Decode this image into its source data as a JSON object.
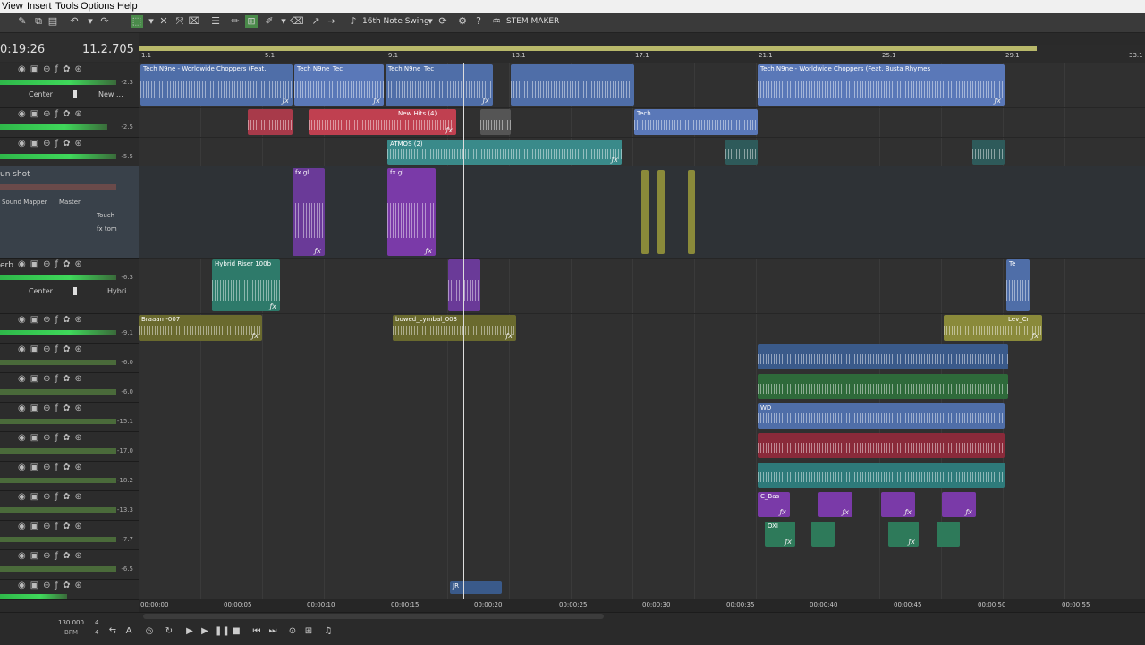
{
  "menu": {
    "view": "View",
    "insert": "Insert",
    "tools": "Tools",
    "options": "Options",
    "help": "Help"
  },
  "toolbar": {
    "swing_label": "16th Note Swing",
    "stem_label": "STEM MAKER"
  },
  "timecode": "0:19:26",
  "measure": "11.2.705",
  "ruler_markers": [
    "1.1",
    "5.1",
    "9.1",
    "13.1",
    "17.1",
    "21.1",
    "25.1",
    "29.1",
    "33.1"
  ],
  "time_markers": [
    "00:00:00",
    "00:00:05",
    "00:00:10",
    "00:00:15",
    "00:00:20",
    "00:00:25",
    "00:00:30",
    "00:00:35",
    "00:00:40",
    "00:00:45",
    "00:00:50",
    "00:00:55"
  ],
  "tracks": [
    {
      "name": "",
      "db": "-2.3",
      "pan": "Center",
      "output": "New ..."
    },
    {
      "name": "",
      "db": "-2.5"
    },
    {
      "name": "",
      "db": "-5.5"
    },
    {
      "name": "un shot",
      "db": "",
      "mapper": "Sound Mapper",
      "master": "Master",
      "mode": "Touch",
      "fx": "fx tom"
    },
    {
      "name": "erb",
      "db": "-6.3",
      "pan": "Center",
      "output": "Hybri..."
    },
    {
      "name": "",
      "db": "-9.1"
    },
    {
      "name": "",
      "db": "-6.0"
    },
    {
      "name": "",
      "db": "-6.0"
    },
    {
      "name": "",
      "db": "-15.1"
    },
    {
      "name": "",
      "db": "-17.0"
    },
    {
      "name": "",
      "db": "-18.2"
    },
    {
      "name": "",
      "db": "-13.3"
    },
    {
      "name": "",
      "db": "-7.7"
    },
    {
      "name": "",
      "db": "-6.5"
    },
    {
      "name": "",
      "db": ""
    }
  ],
  "clips": {
    "c1": "Tech N9ne - Worldwide Choppers (Feat.",
    "c2": "Tech N9ne_Tec",
    "c3": "Tech N9ne_Tec",
    "c4": "Tech N9ne - Worldwide Choppers (Feat. Busta Rhymes",
    "c5": "Tech",
    "c6": "New Hits (4)",
    "c7": "ATMOS (2)",
    "c8": "Hybrid Riser 100b",
    "c9": "Braaam-007",
    "c10": "bowed_cymbal_003",
    "c11": "Lev_Cr",
    "c12": "C_Bas",
    "c13": "OXI",
    "c14": "fx gl",
    "c15": "fx gl",
    "c16": "Te",
    "c17": "WD",
    "c18": "JR"
  },
  "transport": {
    "bpm_value": "130.000",
    "bpm_label": "BPM",
    "sig_top": "4",
    "sig_bottom": "4"
  },
  "colors": {
    "accent": "#3fd85a",
    "loop": "#b8b86a",
    "blue": "#5a78b8",
    "red": "#c04050",
    "purple": "#7a3aa8",
    "teal": "#3a8a8a",
    "olive": "#8a8a3a",
    "green": "#3a9a5a"
  }
}
